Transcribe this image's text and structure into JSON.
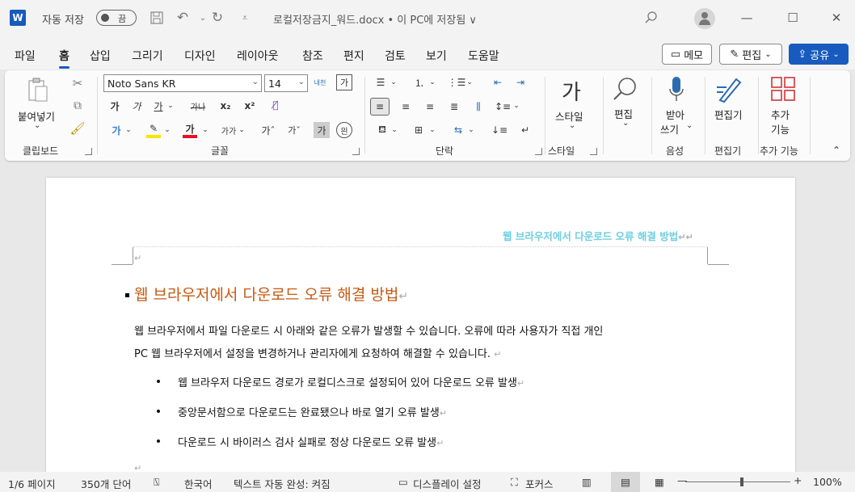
{
  "titlebar": {
    "app_icon": "W",
    "autosave_label": "자동 저장",
    "autosave_state": "끔",
    "doc_title": "로컬저장금지_워드.docx • 이 PC에 저장됨 ∨",
    "icons": [
      "save-icon",
      "undo-icon",
      "redo-icon",
      "customize-icon",
      "search-icon"
    ]
  },
  "menu": {
    "tabs": [
      "파일",
      "홈",
      "삽입",
      "그리기",
      "디자인",
      "레이아웃",
      "참조",
      "편지",
      "검토",
      "보기",
      "도움말"
    ],
    "active_tab": "홈",
    "memo_label": "메모",
    "edit_label": "편집",
    "share_label": "공유"
  },
  "ribbon": {
    "clipboard": {
      "paste_label": "붙여넣기",
      "group_label": "클립보드"
    },
    "font": {
      "font_name": "Noto Sans KR",
      "font_size": "14",
      "group_label": "글꼴"
    },
    "paragraph": {
      "group_label": "단락"
    },
    "styles": {
      "label": "스타일",
      "group_label": "스타일"
    },
    "editing": {
      "label": "편집"
    },
    "voice": {
      "label1": "받아",
      "label2": "쓰기",
      "group_label": "음성"
    },
    "editor": {
      "label": "편집기",
      "group_label": "편집기"
    },
    "addins": {
      "label1": "추가",
      "label2": "기능",
      "group_label": "추가 기능"
    }
  },
  "document": {
    "header_text": "웹 브라우저에서 다운로드 오류 해결 방법",
    "heading": "웹 브라우저에서 다운로드 오류 해결 방법",
    "para_line1": "웹 브라우저에서 파일 다운로드 시 아래와 같은 오류가 발생할 수 있습니다. 오류에 따라 사용자가 직접 개인",
    "para_line2": "PC 웹 브라우저에서 설정을 변경하거나 관리자에게 요청하여 해결할 수 있습니다.",
    "bullets": [
      "웹 브라우저 다운로드 경로가 로컬디스크로 설정되어 있어 다운로드 오류 발생",
      "중앙문서함으로 다운로드는 완료됐으나 바로 열기 오류 발생",
      "다운로드 시 바이러스 검사 실패로 정상 다운로드 오류 발생"
    ]
  },
  "status": {
    "page": "1/6 페이지",
    "words": "350개 단어",
    "language": "한국어",
    "autocomplete": "텍스트 자동 완성: 켜짐",
    "display": "디스플레이 설정",
    "focus": "포커스",
    "zoom": "100%",
    "zoom_value": 100
  }
}
